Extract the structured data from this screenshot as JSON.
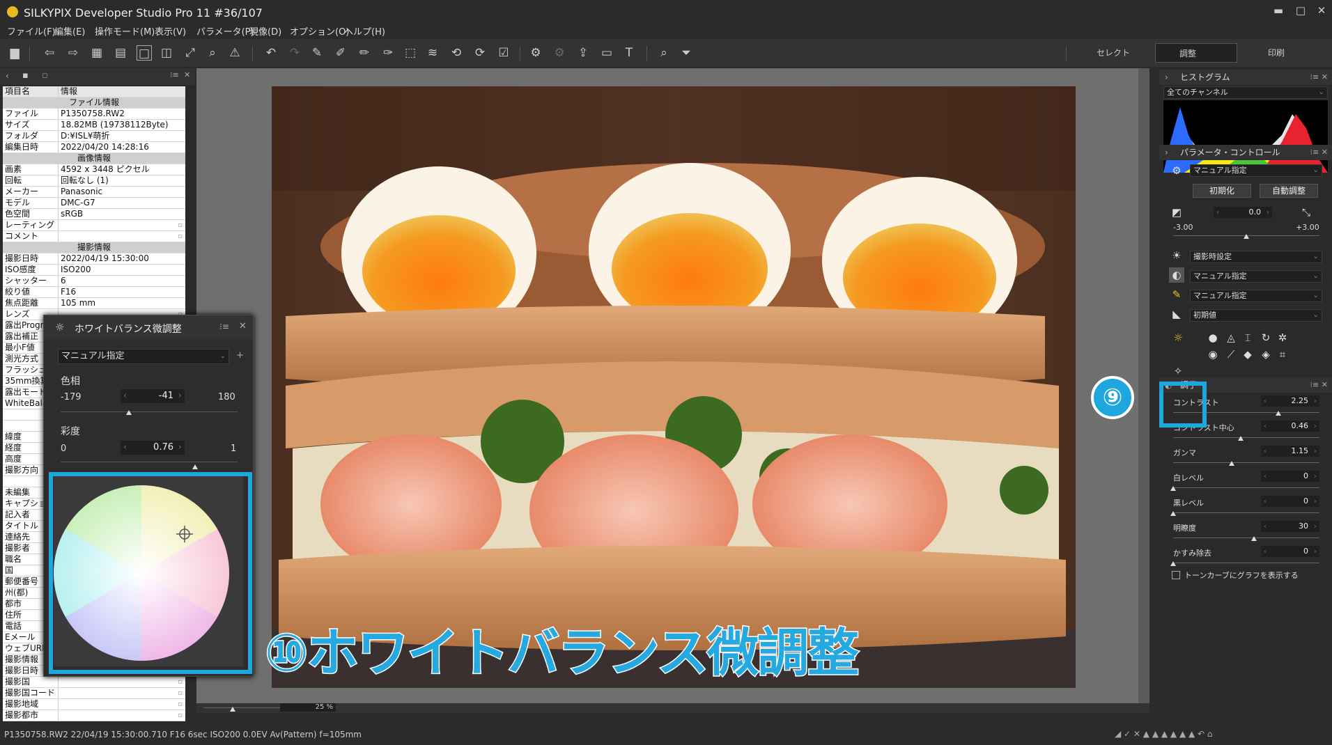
{
  "window": {
    "title": "SILKYPIX Developer Studio Pro 11 #36/107",
    "minimize": "▬",
    "maximize": "□",
    "close": "✕"
  },
  "menu": [
    "ファイル(F)",
    "編集(E)",
    "操作モード(M)",
    "表示(V)",
    "パラメータ(P)",
    "現像(D)",
    "オプション(O)",
    "ヘルプ(H)"
  ],
  "modes": {
    "select": "セレクト",
    "adjust": "調整",
    "print": "印刷"
  },
  "info": {
    "col_key": "項目名",
    "col_val": "情報",
    "rows": [
      {
        "sec": "ファイル情報"
      },
      {
        "k": "ファイル",
        "v": "P1350758.RW2"
      },
      {
        "k": "サイズ",
        "v": "18.82MB (19738112Byte)"
      },
      {
        "k": "フォルダ",
        "v": "D:¥ISL¥萌折"
      },
      {
        "k": "編集日時",
        "v": "2022/04/20 14:28:16"
      },
      {
        "sec": "画像情報"
      },
      {
        "k": "画素",
        "v": "4592 x 3448 ピクセル"
      },
      {
        "k": "回転",
        "v": "回転なし (1)"
      },
      {
        "k": "メーカー",
        "v": "Panasonic"
      },
      {
        "k": "モデル",
        "v": "DMC-G7"
      },
      {
        "k": "色空間",
        "v": "sRGB"
      },
      {
        "k": "レーティング",
        "v": ""
      },
      {
        "k": "コメント",
        "v": ""
      },
      {
        "sec": "撮影情報"
      },
      {
        "k": "撮影日時",
        "v": "2022/04/19 15:30:00"
      },
      {
        "k": "ISO感度",
        "v": "ISO200"
      },
      {
        "k": "シャッター",
        "v": "6"
      },
      {
        "k": "絞り値",
        "v": "F16"
      },
      {
        "k": "焦点距離",
        "v": "105 mm"
      },
      {
        "k": "レンズ",
        "v": ""
      },
      {
        "k": "露出Progr",
        "v": ""
      },
      {
        "k": "露出補正",
        "v": ""
      },
      {
        "k": "最小F値",
        "v": ""
      },
      {
        "k": "測光方式",
        "v": ""
      },
      {
        "k": "フラッシュ",
        "v": ""
      },
      {
        "k": "35mm換算",
        "v": ""
      },
      {
        "k": "露出モード",
        "v": ""
      },
      {
        "k": "WhiteBala",
        "v": ""
      },
      {
        "k": "",
        "v": ""
      },
      {
        "k": "",
        "v": ""
      },
      {
        "k": "緯度",
        "v": ""
      },
      {
        "k": "経度",
        "v": ""
      },
      {
        "k": "高度",
        "v": ""
      },
      {
        "k": "撮影方向",
        "v": ""
      },
      {
        "k": "",
        "v": ""
      },
      {
        "k": "未編集",
        "v": ""
      },
      {
        "k": "キャプション",
        "v": ""
      },
      {
        "k": "記入者",
        "v": ""
      },
      {
        "k": "タイトル",
        "v": ""
      },
      {
        "k": "連絡先",
        "v": ""
      },
      {
        "k": "撮影者",
        "v": ""
      },
      {
        "k": "職名",
        "v": ""
      },
      {
        "k": "国",
        "v": ""
      },
      {
        "k": "郵便番号",
        "v": ""
      },
      {
        "k": "州(都)",
        "v": ""
      },
      {
        "k": "都市",
        "v": ""
      },
      {
        "k": "住所",
        "v": ""
      },
      {
        "k": "電話",
        "v": ""
      },
      {
        "k": "Eメール",
        "v": ""
      },
      {
        "k": "ウェブURL",
        "v": ""
      },
      {
        "k": "撮影情報",
        "v": ""
      },
      {
        "k": "撮影日時",
        "v": ""
      },
      {
        "k": "撮影国",
        "v": ""
      },
      {
        "k": "撮影国コード",
        "v": ""
      },
      {
        "k": "撮影地域",
        "v": ""
      },
      {
        "k": "撮影都市",
        "v": ""
      }
    ]
  },
  "wb_dialog": {
    "title": "ホワイトバランス微調整",
    "preset": "マニュアル指定",
    "hue_label": "色相",
    "hue_min": "-179",
    "hue_value": "-41",
    "hue_max": "180",
    "hue_fraction": 0.385,
    "sat_label": "彩度",
    "sat_min": "0",
    "sat_value": "0.76",
    "sat_max": "1",
    "sat_fraction": 0.76
  },
  "zoom": "25 %",
  "status": "P1350758.RW2 22/04/19 15:30:00.710 F16 6sec ISO200 0.0EV Av(Pattern) f=105mm",
  "histogram": {
    "title": "ヒストグラム",
    "channel": "全てのチャンネル"
  },
  "param_control": {
    "title": "パラメータ・コントロール",
    "preset": "マニュアル指定",
    "reset": "初期化",
    "auto": "自動調整",
    "exposure_value": "0.0",
    "exposure_min": "-3.00",
    "exposure_max": "+3.00",
    "wb_preset": "撮影時設定",
    "tone_preset": "マニュアル指定",
    "sharp_preset": "マニュアル指定",
    "noise_preset": "初期値"
  },
  "tone": {
    "title": "調子",
    "items": [
      {
        "label": "コントラスト",
        "value": "2.25",
        "fraction": 0.72
      },
      {
        "label": "コントラスト中心",
        "value": "0.46",
        "fraction": 0.46
      },
      {
        "label": "ガンマ",
        "value": "1.15",
        "fraction": 0.4
      },
      {
        "label": "白レベル",
        "value": "0",
        "fraction": 0.0
      },
      {
        "label": "黒レベル",
        "value": "0",
        "fraction": 0.0
      },
      {
        "label": "明瞭度",
        "value": "30",
        "fraction": 0.55
      },
      {
        "label": "かすみ除去",
        "value": "0",
        "fraction": 0.0
      }
    ],
    "curve_checkbox": "トーンカーブにグラフを表示する"
  },
  "annotations": {
    "badge9": "⑨",
    "big_label": "⑩ホワイトバランス微調整",
    "accent": "#1ea7df"
  }
}
